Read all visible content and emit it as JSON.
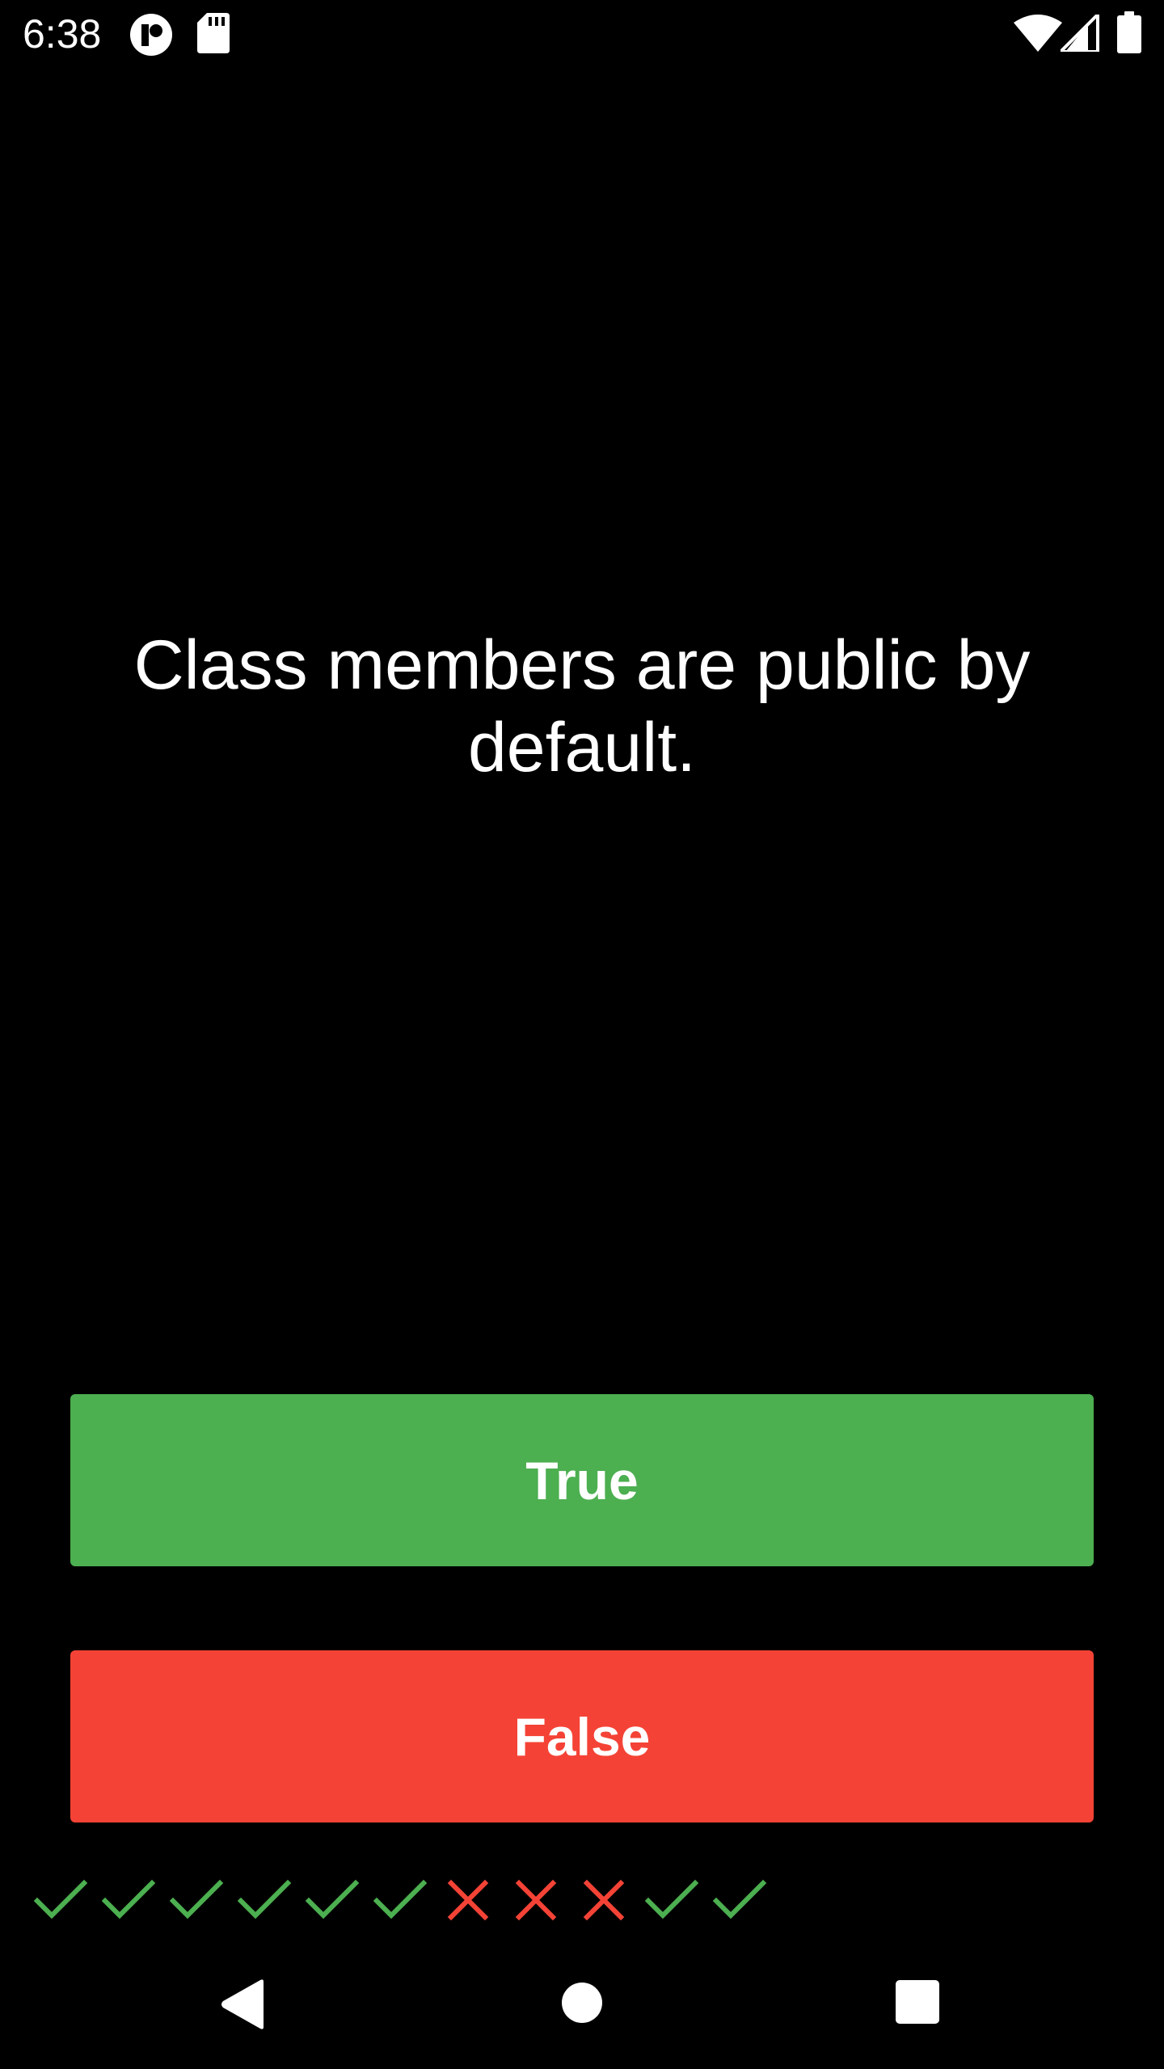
{
  "status_bar": {
    "time": "6:38",
    "icons": [
      "app-notification-icon",
      "sd-card-icon",
      "wifi-icon",
      "cell-signal-icon",
      "battery-icon"
    ]
  },
  "question": {
    "text": "Class members are public by default."
  },
  "buttons": {
    "true_label": "True",
    "false_label": "False"
  },
  "score_marks": [
    "correct",
    "correct",
    "correct",
    "correct",
    "correct",
    "correct",
    "incorrect",
    "incorrect",
    "incorrect",
    "correct",
    "correct"
  ],
  "colors": {
    "true_button": "#4CAF50",
    "false_button": "#F44336",
    "correct_mark": "#4CAF50",
    "incorrect_mark": "#F44336",
    "background": "#000000"
  },
  "nav_bar": {
    "icons": [
      "back-icon",
      "home-icon",
      "recents-icon"
    ]
  }
}
